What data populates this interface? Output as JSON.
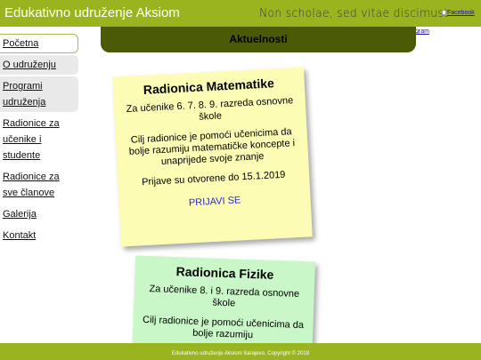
{
  "header": {
    "title": "Edukativno udruženje Aksiom",
    "motto": "Non scholae, sed vitae discimust",
    "facebook_link": "Facebook",
    "instagram_link": "gram"
  },
  "sidebar": {
    "items": [
      {
        "label": "Početna",
        "active": true
      },
      {
        "label": "O udruženju"
      },
      {
        "label": "Programi udruženja"
      },
      {
        "label": "Radionice za učenike i studente"
      },
      {
        "label": "Radionice za sve članove"
      },
      {
        "label": "Galerija"
      },
      {
        "label": "Kontakt"
      }
    ]
  },
  "main": {
    "section_title": "Aktuelnosti",
    "cards": [
      {
        "title": "Radionica Matematike",
        "audience": "Za učenike 6. 7. 8. 9. razreda osnovne škole",
        "goal": "Cilj radionice je pomoći učenicima da bolje razumiju matematičke koncepte i unaprijede svoje znanje",
        "registration": "Prijave su otvorene do 15.1.2019",
        "cta": "PRIJAVI SE",
        "color": "#fcfcb5"
      },
      {
        "title": "Radionica Fizike",
        "audience": "Za učenike 8. i 9. razreda osnovne škole",
        "goal": "Cilj radionice je pomoći učenicima da bolje razumiju",
        "color": "#c9f7c8"
      }
    ]
  },
  "footer": {
    "text": "Edukativno udruženje Aksiom Sarajevo, Copyright © 2018"
  },
  "colors": {
    "brand": "#99b41f",
    "section_bar": "#4a5a06",
    "link": "#2a2ad0"
  }
}
